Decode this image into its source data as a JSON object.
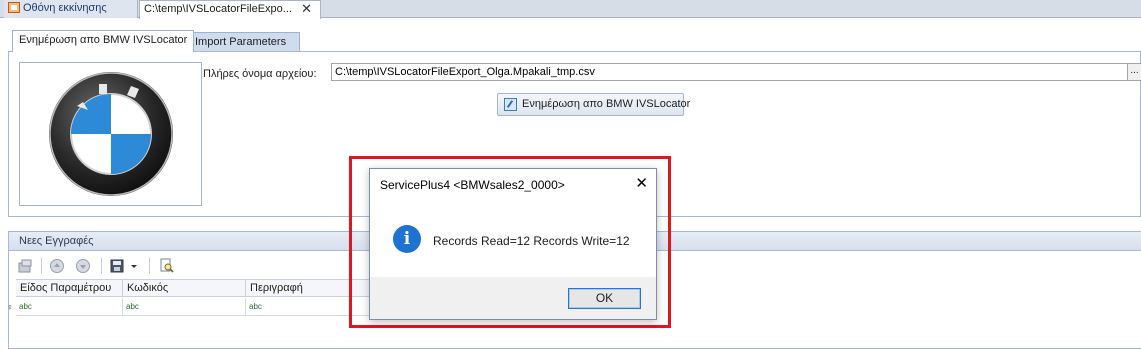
{
  "doc_tabs": {
    "home_label": "Οθόνη εκκίνησης",
    "active_label": "C:\\temp\\IVSLocatorFileExpo...",
    "close_glyph": "✕"
  },
  "inner_tabs": [
    {
      "label": "Ενημέρωση απο BMW IVSLocator"
    },
    {
      "label": "Import Parameters"
    }
  ],
  "form": {
    "file_label": "Πλήρες όνομα αρχείου:",
    "file_value": "C:\\temp\\IVSLocatorFileExport_Olga.Mpakali_tmp.csv",
    "ellipsis": "...",
    "update_button": "Ενημέρωση απο BMW IVSLocator"
  },
  "records": {
    "header": "Νεες Εγγραφές",
    "columns": [
      "Είδος Παραμέτρου",
      "Κωδικός",
      "Περιγραφή"
    ],
    "rows": [
      [
        "abc",
        "abc",
        "abc"
      ]
    ],
    "row_indicator": "♀"
  },
  "dialog": {
    "title": "ServicePlus4  <BMWsales2_0000>",
    "close_glyph": "✕",
    "icon": "info-icon",
    "message": "Records Read=12   Records Write=12",
    "ok_label": "OK"
  },
  "colors": {
    "highlight_frame": "#e0161e",
    "info_blue": "#1f73d0"
  }
}
